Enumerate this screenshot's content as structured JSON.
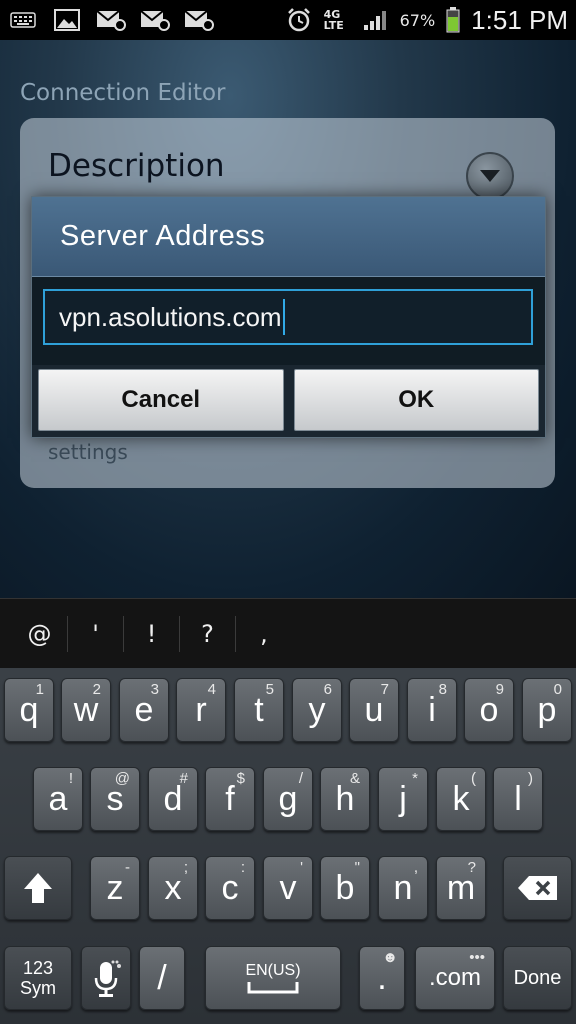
{
  "status_bar": {
    "battery": "67%",
    "time": "1:51 PM",
    "network": "4G LTE"
  },
  "background": {
    "app_title": "Connection Editor",
    "description_label": "Description",
    "settings_label": "settings"
  },
  "dialog": {
    "title": "Server Address",
    "input_value": "vpn.asolutions.com",
    "cancel_label": "Cancel",
    "ok_label": "OK"
  },
  "suggestions": [
    "@",
    "'",
    "!",
    "?",
    ","
  ],
  "keyboard": {
    "row1": [
      {
        "k": "q",
        "s": "1"
      },
      {
        "k": "w",
        "s": "2"
      },
      {
        "k": "e",
        "s": "3"
      },
      {
        "k": "r",
        "s": "4"
      },
      {
        "k": "t",
        "s": "5"
      },
      {
        "k": "y",
        "s": "6"
      },
      {
        "k": "u",
        "s": "7"
      },
      {
        "k": "i",
        "s": "8"
      },
      {
        "k": "o",
        "s": "9"
      },
      {
        "k": "p",
        "s": "0"
      }
    ],
    "row2": [
      {
        "k": "a",
        "s": "!"
      },
      {
        "k": "s",
        "s": "@"
      },
      {
        "k": "d",
        "s": "#"
      },
      {
        "k": "f",
        "s": "$"
      },
      {
        "k": "g",
        "s": "/"
      },
      {
        "k": "h",
        "s": "&"
      },
      {
        "k": "j",
        "s": "*"
      },
      {
        "k": "k",
        "s": "("
      },
      {
        "k": "l",
        "s": ")"
      }
    ],
    "row3": [
      {
        "k": "z",
        "s": "-"
      },
      {
        "k": "x",
        "s": ";"
      },
      {
        "k": "c",
        "s": ":"
      },
      {
        "k": "v",
        "s": "'"
      },
      {
        "k": "b",
        "s": "\""
      },
      {
        "k": "n",
        "s": ","
      },
      {
        "k": "m",
        "s": "?"
      }
    ],
    "sym_label": "123\nSym",
    "slash_label": "/",
    "space_label": "EN(US)",
    "period_label": ".",
    "dotcom_label": ".com",
    "done_label": "Done"
  },
  "colors": {
    "accent": "#2fa0d8",
    "dialog_header": "#4f7292",
    "battery": "#7ec832"
  }
}
